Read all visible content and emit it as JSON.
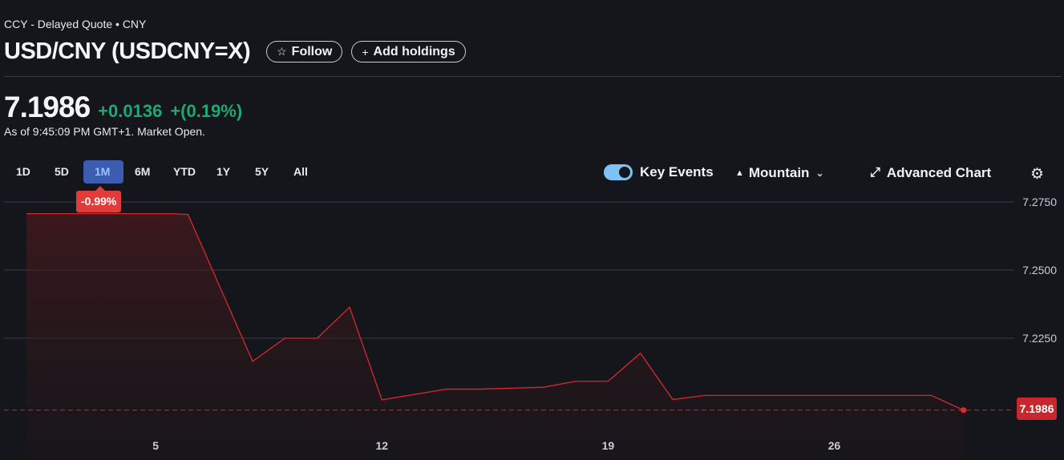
{
  "header": {
    "source": "CCY - Delayed Quote • CNY",
    "title": "USD/CNY (USDCNY=X)",
    "follow_label": "Follow",
    "add_holdings_label": "Add holdings"
  },
  "quote": {
    "price": "7.1986",
    "change": "+0.0136",
    "change_pct": "+(0.19%)",
    "as_of": "As of 9:45:09 PM GMT+1. Market Open."
  },
  "ranges": [
    "1D",
    "5D",
    "1M",
    "6M",
    "YTD",
    "1Y",
    "5Y",
    "All"
  ],
  "active_range": "1M",
  "controls": {
    "key_events_label": "Key Events",
    "key_events_on": true,
    "chart_style_label": "Mountain",
    "advanced_chart_label": "Advanced Chart"
  },
  "performance_badge": "-0.99%",
  "last_price_label": "7.1986",
  "colors": {
    "background": "#15161b",
    "line": "#d42a2f",
    "positive": "#1fa774",
    "negative": "#e03c3c",
    "active_range": "#3c5cb1"
  },
  "chart_data": {
    "type": "area",
    "x_ticks": [
      "5",
      "12",
      "19",
      "26"
    ],
    "x": [
      1,
      5.5,
      6,
      8,
      9,
      10,
      11,
      12,
      14,
      15,
      17,
      18,
      19,
      20,
      21,
      22,
      23,
      25,
      26,
      27,
      28,
      29,
      30
    ],
    "values": [
      7.2707,
      7.2707,
      7.2704,
      7.2165,
      7.225,
      7.225,
      7.2364,
      7.2024,
      7.2063,
      7.2063,
      7.207,
      7.2092,
      7.2092,
      7.2195,
      7.2025,
      7.204,
      7.204,
      7.204,
      7.204,
      7.204,
      7.204,
      7.204,
      7.1986
    ],
    "prev_close": 7.1986,
    "y_ticks": [
      "7.2750",
      "7.2500",
      "7.2250"
    ],
    "ylim": [
      7.1826,
      7.2797
    ],
    "xlim": [
      0,
      31.2
    ],
    "grid": true
  }
}
